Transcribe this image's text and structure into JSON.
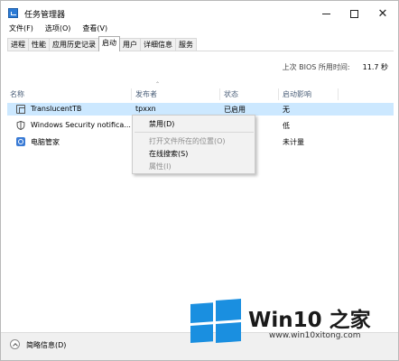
{
  "window": {
    "title": "任务管理器",
    "controls": {
      "minimize": "—",
      "maximize": "☐",
      "close": "✕"
    }
  },
  "menu": [
    "文件(F)",
    "选项(O)",
    "查看(V)"
  ],
  "tabs": [
    {
      "label": "进程",
      "active": false
    },
    {
      "label": "性能",
      "active": false
    },
    {
      "label": "应用历史记录",
      "active": false
    },
    {
      "label": "启动",
      "active": true
    },
    {
      "label": "用户",
      "active": false
    },
    {
      "label": "详细信息",
      "active": false
    },
    {
      "label": "服务",
      "active": false
    }
  ],
  "bios": {
    "label": "上次 BIOS 所用时间:",
    "value": "11.7 秒"
  },
  "columns": {
    "name": "名称",
    "publisher": "发布者",
    "status": "状态",
    "impact": "启动影响"
  },
  "rows": [
    {
      "name": "TranslucentTB",
      "publisher": "tpxxn",
      "status": "已启用",
      "impact": "无",
      "icon": "translucenttb-icon",
      "selected": true
    },
    {
      "name": "Windows Security notifica...",
      "publisher": "",
      "status": "",
      "impact": "低",
      "icon": "shield-icon",
      "selected": false
    },
    {
      "name": "电脑管家",
      "publisher": "",
      "status": "",
      "impact": "未计量",
      "icon": "pc-manager-icon",
      "selected": false
    }
  ],
  "context_menu": {
    "items": [
      {
        "label": "禁用(D)",
        "enabled": true
      },
      {
        "label": "打开文件所在的位置(O)",
        "enabled": false
      },
      {
        "label": "在线搜索(S)",
        "enabled": true
      },
      {
        "label": "属性(I)",
        "enabled": false
      }
    ]
  },
  "footer": {
    "label": "简略信息(D)"
  },
  "watermark": {
    "title_main": "Win10",
    "title_cn": "之家",
    "url": "www.win10xitong.com"
  }
}
